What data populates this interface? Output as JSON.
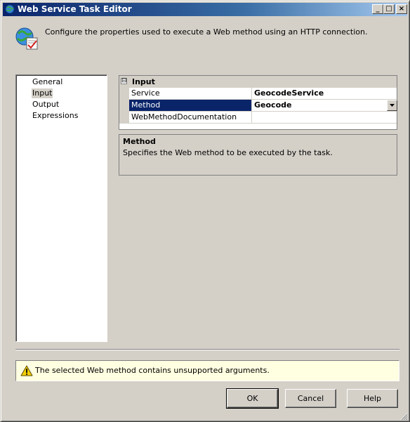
{
  "window": {
    "title": "Web Service Task Editor",
    "controls": {
      "minimize": "_",
      "maximize": "□",
      "close": "×"
    }
  },
  "header": {
    "icon": "web-service-task-icon",
    "description": "Configure the properties used to execute a Web method using an HTTP connection."
  },
  "nav": {
    "items": [
      {
        "label": "General"
      },
      {
        "label": "Input",
        "selected": true
      },
      {
        "label": "Output"
      },
      {
        "label": "Expressions"
      }
    ]
  },
  "properties": {
    "category": "Input",
    "expander": "⊟",
    "rows": [
      {
        "name": "Service",
        "value": "GeocodeService"
      },
      {
        "name": "Method",
        "value": "Geocode",
        "selected": true,
        "has_dropdown": true
      },
      {
        "name": "WebMethodDocumentation",
        "value": ""
      }
    ]
  },
  "description": {
    "title": "Method",
    "text": "Specifies the Web method to be executed by the task."
  },
  "message": {
    "icon": "warning-icon",
    "text": "The selected Web method contains unsupported arguments."
  },
  "buttons": {
    "ok": "OK",
    "cancel": "Cancel",
    "help": "Help"
  },
  "colors": {
    "title_bar": "#0a246a",
    "selection": "#0a246a",
    "dialog_bg": "#d4d0c8",
    "message_bg": "#ffffe1"
  }
}
